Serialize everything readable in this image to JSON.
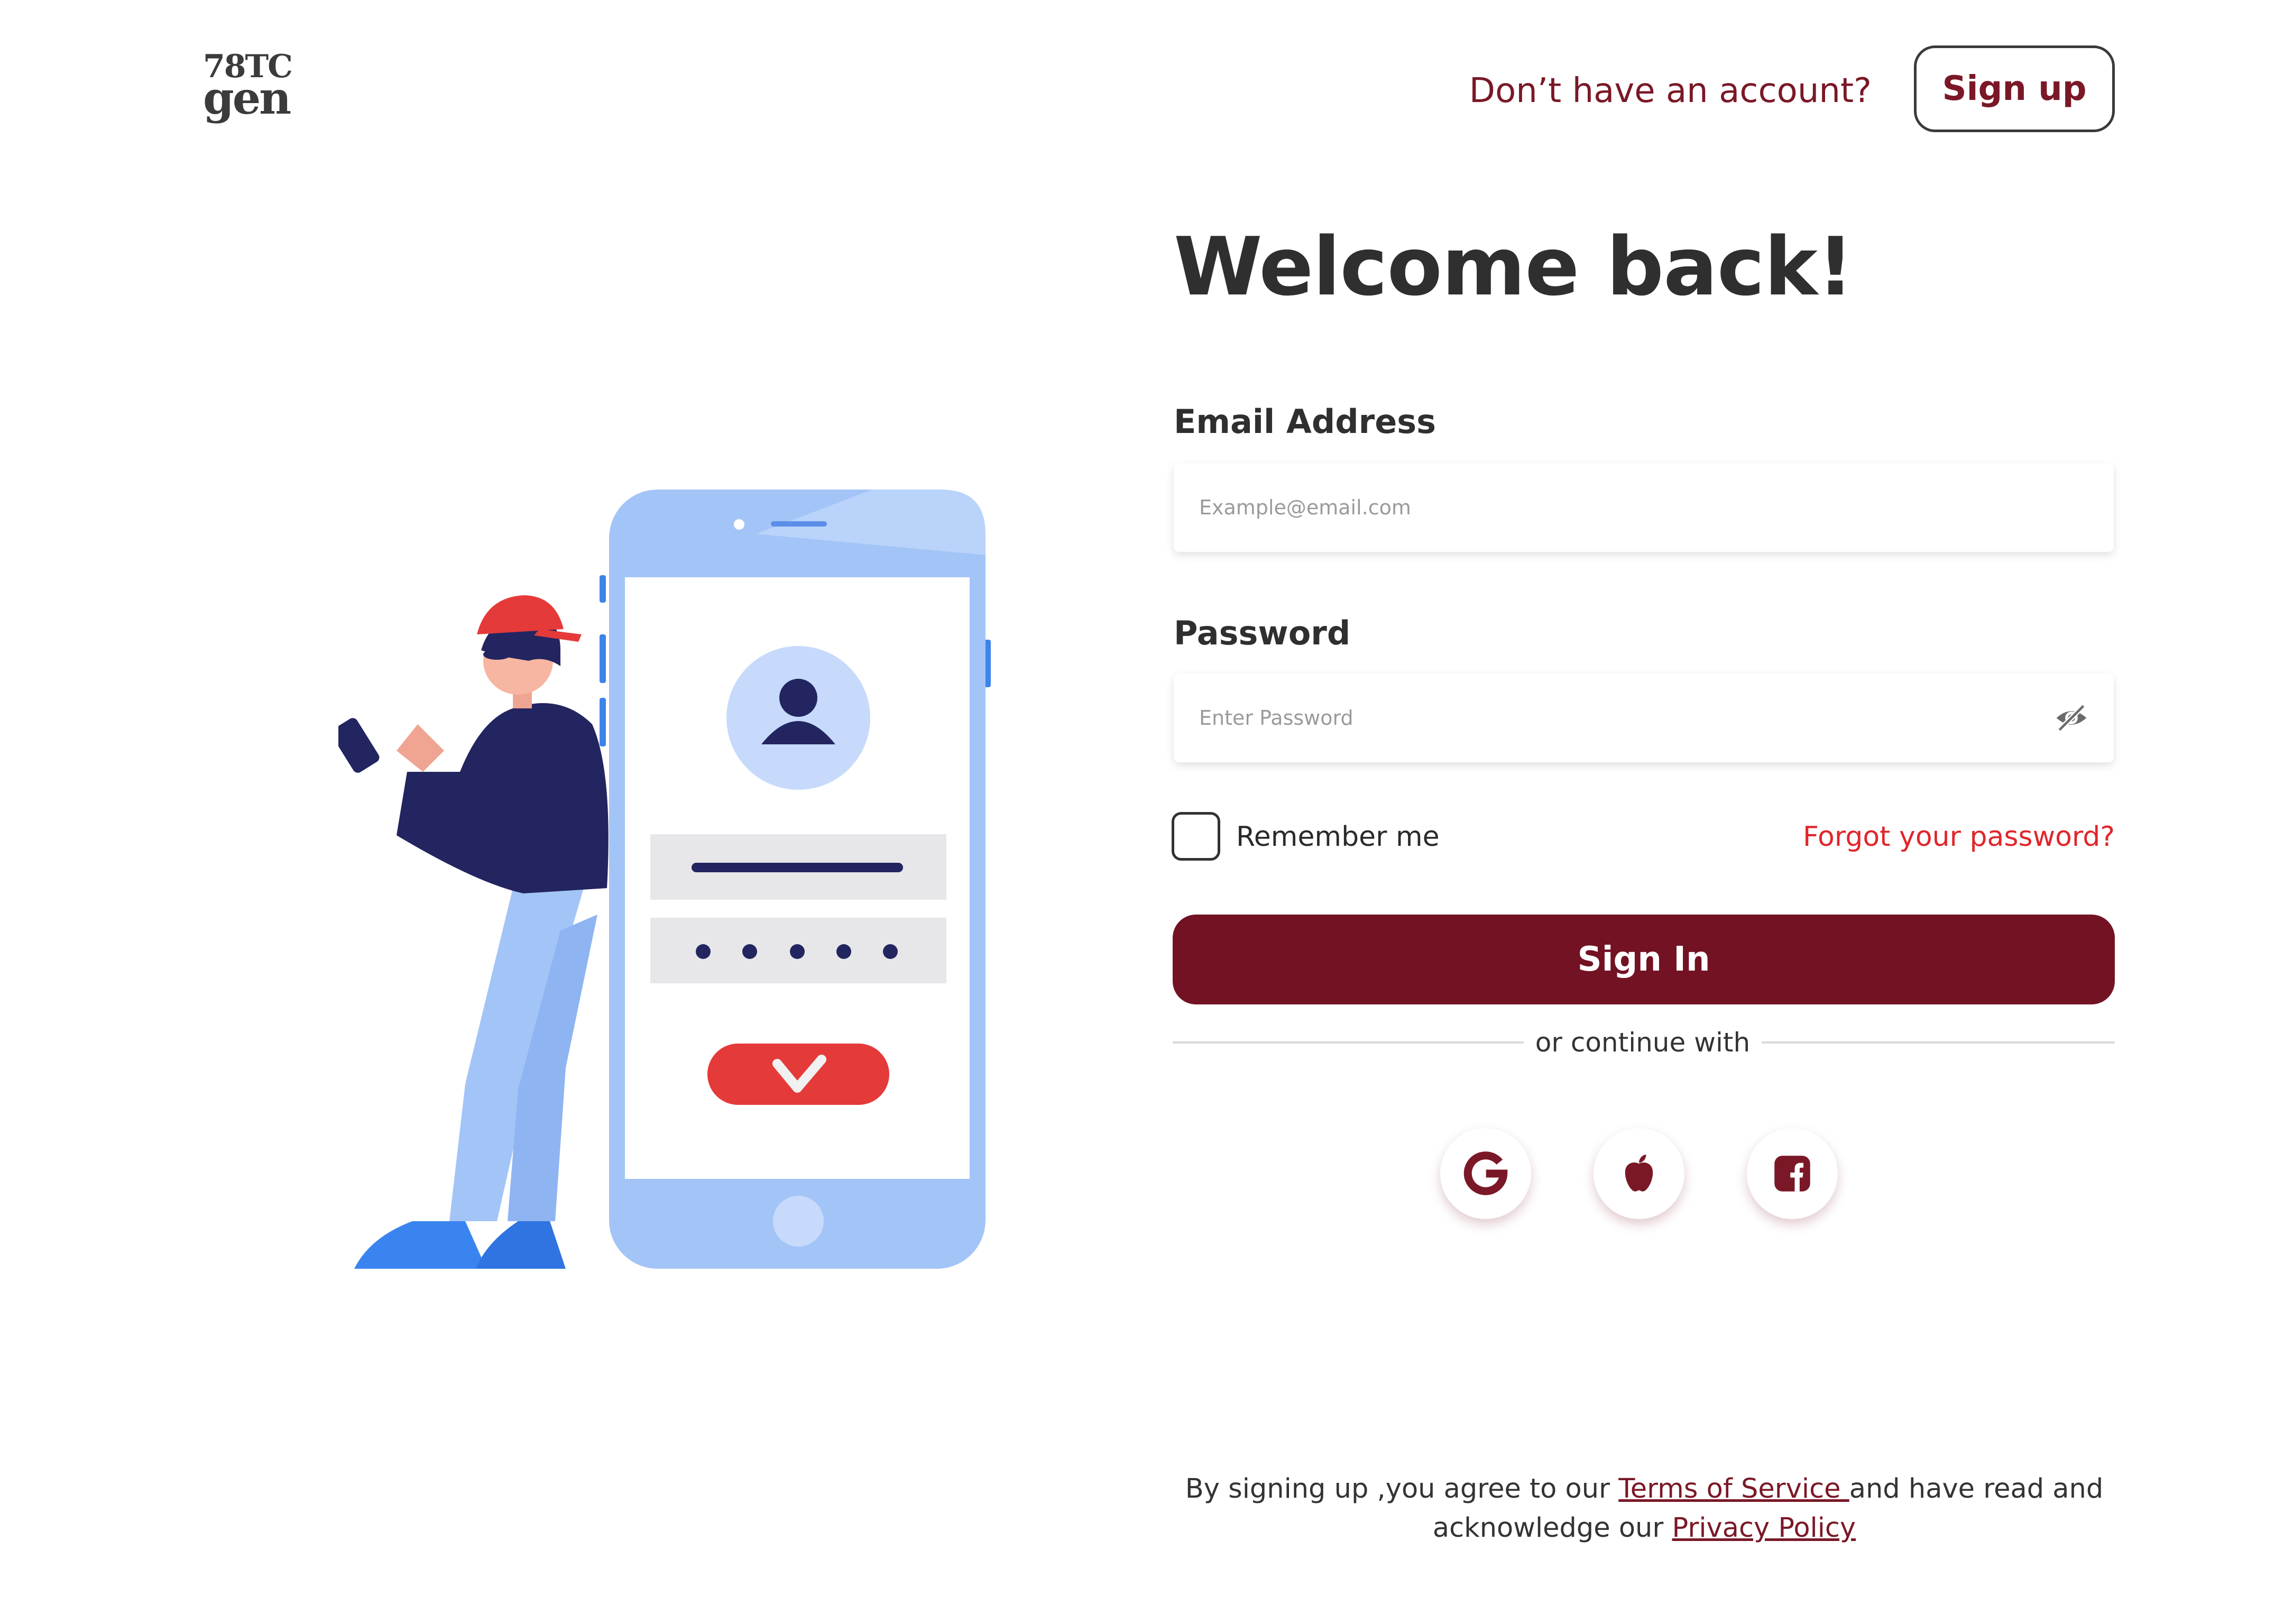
{
  "logo": {
    "line1": "78TC",
    "line2": "gen"
  },
  "header": {
    "prompt": "Don’t have an account?",
    "signup_label": "Sign up"
  },
  "title": "Welcome back!",
  "email": {
    "label": "Email Address",
    "placeholder": "Example@email.com",
    "value": ""
  },
  "password": {
    "label": "Password",
    "placeholder": "Enter Password",
    "value": "",
    "toggle_icon": "eye-off-icon"
  },
  "remember": {
    "label": "Remember me",
    "checked": false
  },
  "forgot": {
    "label": "Forgot your password?"
  },
  "signin": {
    "label": "Sign In"
  },
  "divider": {
    "label": "or continue with"
  },
  "social": [
    {
      "name": "google",
      "icon": "google-icon"
    },
    {
      "name": "apple",
      "icon": "apple-icon"
    },
    {
      "name": "facebook",
      "icon": "facebook-icon"
    }
  ],
  "legal": {
    "prefix": "By signing up ,you agree to our ",
    "terms_label": "Terms of Service ",
    "middle": "and have read and acknowledge our ",
    "privacy_label": "Privacy Policy"
  },
  "colors": {
    "brand": "#721223",
    "brand_text": "#7a1827",
    "link_red": "#e0262b",
    "illustration_blue": "#a3c4f7",
    "navy": "#232560"
  }
}
